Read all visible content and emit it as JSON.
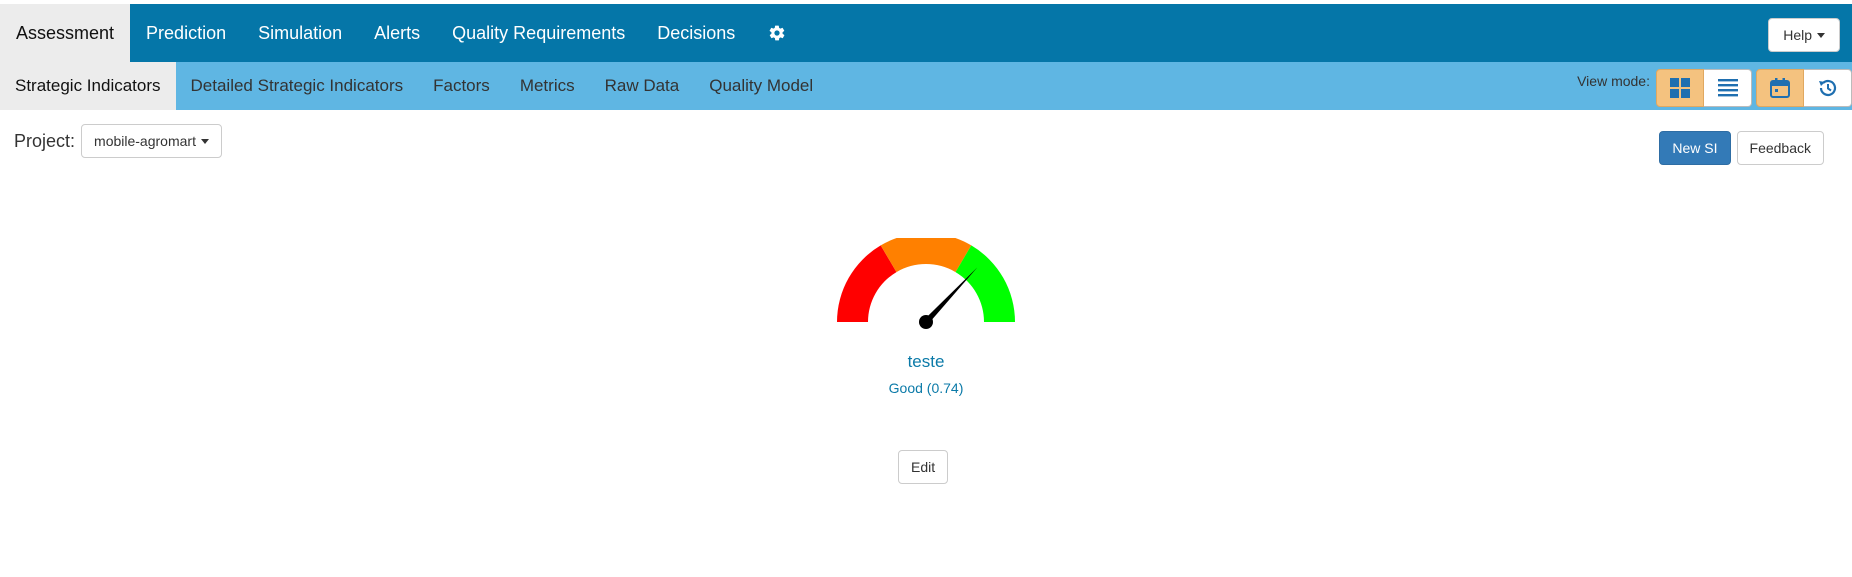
{
  "topnav": {
    "tabs": [
      {
        "label": "Assessment",
        "active": true
      },
      {
        "label": "Prediction",
        "active": false
      },
      {
        "label": "Simulation",
        "active": false
      },
      {
        "label": "Alerts",
        "active": false
      },
      {
        "label": "Quality Requirements",
        "active": false
      },
      {
        "label": "Decisions",
        "active": false
      }
    ],
    "settings_icon": "gear-icon",
    "help_label": "Help"
  },
  "subnav": {
    "tabs": [
      {
        "label": "Strategic Indicators",
        "active": true
      },
      {
        "label": "Detailed Strategic Indicators",
        "active": false
      },
      {
        "label": "Factors",
        "active": false
      },
      {
        "label": "Metrics",
        "active": false
      },
      {
        "label": "Raw Data",
        "active": false
      },
      {
        "label": "Quality Model",
        "active": false
      }
    ],
    "view_mode_label": "View mode:",
    "view_modes": [
      {
        "icon": "grid-icon",
        "active": true
      },
      {
        "icon": "list-icon",
        "active": false
      }
    ],
    "time_modes": [
      {
        "icon": "calendar-icon",
        "active": true
      },
      {
        "icon": "history-icon",
        "active": false
      }
    ]
  },
  "project": {
    "label": "Project:",
    "selected": "mobile-agromart"
  },
  "actions": {
    "new_si_label": "New SI",
    "feedback_label": "Feedback"
  },
  "gauge": {
    "name": "teste",
    "status_text": "Good (0.74)",
    "value": 0.74,
    "bands": [
      {
        "from": 0,
        "to": 0.33,
        "color": "#ff0000"
      },
      {
        "from": 0.33,
        "to": 0.67,
        "color": "#ff8000"
      },
      {
        "from": 0.67,
        "to": 1.0,
        "color": "#00ff00"
      }
    ],
    "needle_color": "#000000"
  },
  "edit_label": "Edit",
  "colors": {
    "topbar": "#0576a8",
    "subbar": "#5fb6e3",
    "accent_text": "#0b7aa8",
    "active_toggle": "#f4c27f",
    "primary_button": "#337ab7"
  }
}
